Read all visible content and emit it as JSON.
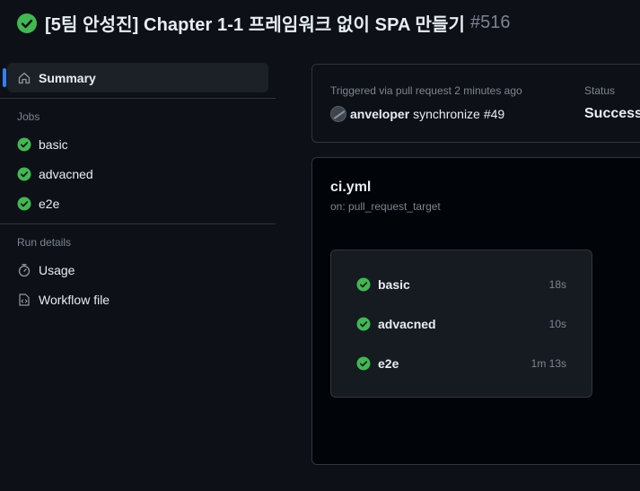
{
  "header": {
    "title": "[5팀 안성진] Chapter 1-1 프레임워크 없이 SPA 만들기",
    "run_number": "#516"
  },
  "sidebar": {
    "summary_label": "Summary",
    "jobs_heading": "Jobs",
    "jobs": [
      {
        "label": "basic"
      },
      {
        "label": "advacned"
      },
      {
        "label": "e2e"
      }
    ],
    "run_details_heading": "Run details",
    "usage_label": "Usage",
    "workflow_file_label": "Workflow file"
  },
  "summary": {
    "trigger_text": "Triggered via pull request 2 minutes ago",
    "actor": "anveloper",
    "event": "synchronize",
    "pr_number": "#49",
    "status_label": "Status",
    "status_value": "Success"
  },
  "workflow": {
    "name": "ci.yml",
    "trigger": "on: pull_request_target",
    "jobs": [
      {
        "name": "basic",
        "duration": "18s"
      },
      {
        "name": "advacned",
        "duration": "10s"
      },
      {
        "name": "e2e",
        "duration": "1m 13s"
      }
    ]
  },
  "colors": {
    "success": "#3fb950",
    "accent": "#2f81f7",
    "background": "#0d1117"
  }
}
